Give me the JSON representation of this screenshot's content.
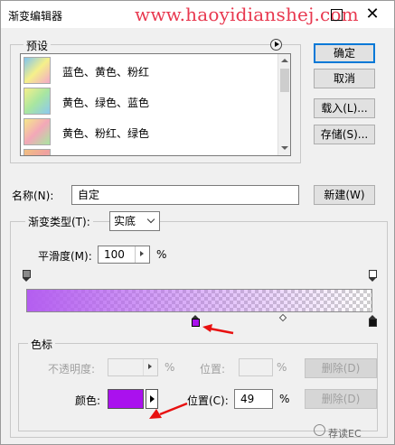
{
  "window": {
    "title": "渐变编辑器",
    "watermark": "www.haoyidianshej.com",
    "close_glyph": "✕"
  },
  "presets": {
    "label": "预设",
    "items": [
      {
        "name": "蓝色、黄色、粉红",
        "colors": [
          "#7fc4f0",
          "#f5f08a",
          "#f3a8c8"
        ]
      },
      {
        "name": "黄色、绿色、蓝色",
        "colors": [
          "#f5f08a",
          "#a8e6a0",
          "#8cc8f0"
        ]
      },
      {
        "name": "黄色、粉红、绿色",
        "colors": [
          "#f5e88a",
          "#f3a8b8",
          "#a8e6a0"
        ]
      },
      {
        "name": "",
        "colors": [
          "#f0c080",
          "#f0a0a0",
          "#c0e0a0"
        ]
      }
    ]
  },
  "buttons": {
    "ok": "确定",
    "cancel": "取消",
    "load": "载入(L)...",
    "save": "存储(S)...",
    "new": "新建(W)"
  },
  "name_field": {
    "label": "名称(N):",
    "value": "自定"
  },
  "gradient": {
    "type_label": "渐变类型(T):",
    "type_value": "实底",
    "smoothness_label": "平滑度(M):",
    "smoothness_value": "100",
    "smoothness_unit": "%",
    "start_color": "#b45ef0",
    "end_color": "#ffffff",
    "opacity_stop_start": 0,
    "opacity_stop_end": 1,
    "color_stop_active": 0.49,
    "color_stop_end": 1,
    "midpoint": 0.745
  },
  "color_stops": {
    "label": "色标",
    "opacity_label": "不透明度:",
    "opacity_unit": "%",
    "location_label_top": "位置:",
    "location_unit_top": "%",
    "delete_label_top": "删除(D)",
    "color_label": "颜色:",
    "color_value": "#aa11ee",
    "location_label": "位置(C):",
    "location_value": "49",
    "location_unit": "%",
    "delete_label": "删除(D)"
  },
  "corner_watermark": "荐读EC",
  "colors": {
    "accent_button_border": "#0078d7",
    "annotation_red": "#e81010"
  }
}
